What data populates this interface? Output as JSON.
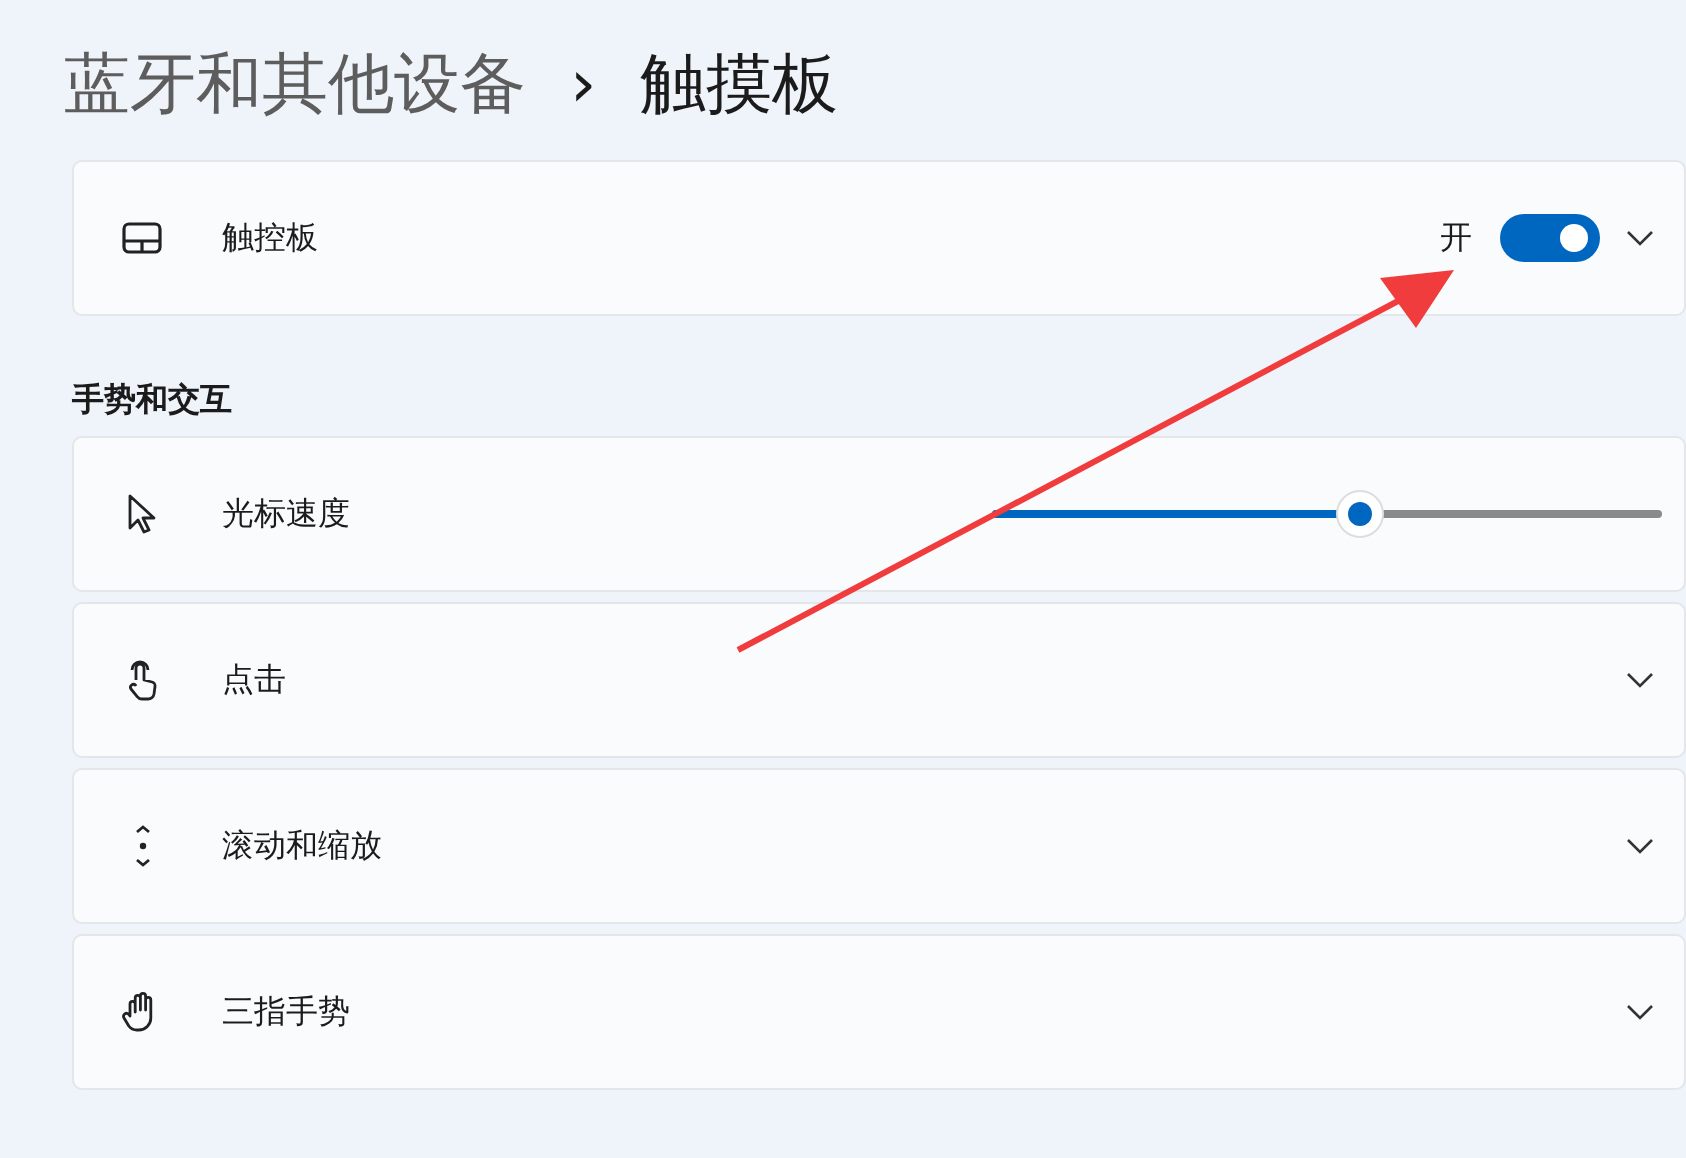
{
  "breadcrumb": {
    "parent": "蓝牙和其他设备",
    "separator": "›",
    "current": "触摸板"
  },
  "top_card": {
    "kind": "toggle",
    "label": "触控板",
    "state_text": "开",
    "on": true
  },
  "section_title": "手势和交互",
  "rows": [
    {
      "kind": "slider",
      "label": "光标速度",
      "level": 0.55
    },
    {
      "kind": "expander",
      "label": "点击"
    },
    {
      "kind": "expander",
      "label": "滚动和缩放"
    },
    {
      "kind": "expander",
      "label": "三指手势"
    }
  ],
  "annotation": {
    "kind": "arrow"
  }
}
